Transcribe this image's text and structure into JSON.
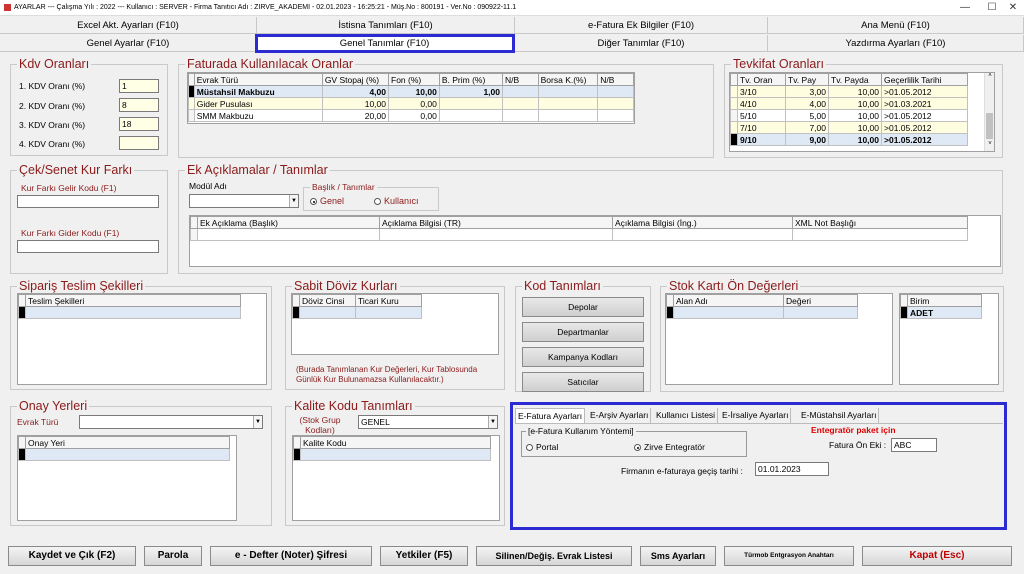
{
  "window": {
    "title": "AYARLAR --- Çalışma Yılı : 2022 --- Kullanıcı : SERVER - Firma Tanıtıcı Adı : ZIRVE_AKADEMI - 02.01.2023 - 16:25:21 - Müş.No : 800191 - Ver.No : 090922-11.1"
  },
  "tabs_row1": [
    "Excel Akt. Ayarları (F10)",
    "İstisna Tanımları (F10)",
    "e-Fatura Ek Bilgiler (F10)",
    "Ana Menü (F10)"
  ],
  "tabs_row2": [
    "Genel Ayarlar (F10)",
    "Genel Tanımlar (F10)",
    "Diğer Tanımlar (F10)",
    "Yazdırma Ayarları (F10)"
  ],
  "kdv": {
    "title": "Kdv Oranları",
    "labels": [
      "1. KDV Oranı (%)",
      "2. KDV Oranı (%)",
      "3. KDV Oranı (%)",
      "4. KDV Oranı (%)"
    ],
    "values": [
      "1",
      "8",
      "18",
      ""
    ]
  },
  "faturada": {
    "title": "Faturada Kullanılacak Oranlar",
    "headers": [
      "Evrak Türü",
      "GV Stopaj (%)",
      "Fon (%)",
      "B. Prim (%)",
      "N/B",
      "Borsa K.(%)",
      "N/B"
    ],
    "rows": [
      [
        "Müstahsil Makbuzu",
        "4,00",
        "10,00",
        "1,00",
        "",
        "",
        ""
      ],
      [
        "Gider Pusulası",
        "10,00",
        "0,00",
        "",
        "",
        "",
        ""
      ],
      [
        "SMM Makbuzu",
        "20,00",
        "0,00",
        "",
        "",
        "",
        ""
      ]
    ]
  },
  "tevkifat": {
    "title": "Tevkifat Oranları",
    "headers": [
      "Tv. Oran",
      "Tv. Pay",
      "Tv. Payda",
      "Geçerlilik Tarihi"
    ],
    "rows": [
      [
        "3/10",
        "3,00",
        "10,00",
        ">01.05.2012"
      ],
      [
        "4/10",
        "4,00",
        "10,00",
        ">01.03.2021"
      ],
      [
        "5/10",
        "5,00",
        "10,00",
        ">01.05.2012"
      ],
      [
        "7/10",
        "7,00",
        "10,00",
        ">01.05.2012"
      ],
      [
        "9/10",
        "9,00",
        "10,00",
        ">01.05.2012"
      ]
    ]
  },
  "cek_senet": {
    "title": "Çek/Senet Kur Farkı",
    "gelir_label": "Kur Farkı Gelir Kodu (F1)",
    "gider_label": "Kur Farkı Gider Kodu (F1)"
  },
  "ek_aciklama": {
    "title": "Ek Açıklamalar / Tanımlar",
    "modul_label": "Modül Adı",
    "baslik_group": "Başlık / Tanımlar",
    "radio_genel": "Genel",
    "radio_kullanici": "Kullanıcı",
    "headers": [
      "Ek Açıklama (Başlık)",
      "Açıklama Bilgisi (TR)",
      "Açıklama Bilgisi (İng.)",
      "XML Not Başlığı"
    ]
  },
  "siparis": {
    "title": "Sipariş Teslim Şekilleri",
    "header": "Teslim Şekilleri"
  },
  "sabit_doviz": {
    "title": "Sabit Döviz Kurları",
    "headers": [
      "Döviz Cinsi",
      "Ticari Kuru"
    ],
    "note": "(Burada Tanımlanan Kur Değerleri, Kur Tablosunda Günlük Kur Bulunamazsa Kullanılacaktır.)"
  },
  "kod_tanimlari": {
    "title": "Kod Tanımları",
    "buttons": [
      "Depolar",
      "Departmanlar",
      "Kampanya Kodları",
      "Satıcılar"
    ]
  },
  "stok_karti": {
    "title": "Stok Kartı Ön Değerleri",
    "headers": [
      "Alan Adı",
      "Değeri"
    ],
    "birim_header": "Birim",
    "birim_value": "ADET"
  },
  "onay": {
    "title": "Onay Yerleri",
    "evrak_label": "Evrak Türü",
    "header": "Onay Yeri"
  },
  "kalite": {
    "title": "Kalite Kodu Tanımları",
    "grup_label": "(Stok Grup Kodları)",
    "grup_value": "GENEL",
    "header": "Kalite Kodu"
  },
  "efatura": {
    "tabs": [
      "E-Fatura Ayarları",
      "E-Arşiv Ayarları",
      "Kullanıcı Listesi",
      "E-İrsaliye Ayarları",
      "E-Müstahsil Ayarları"
    ],
    "yontem_title": "[e-Fatura Kullanım Yöntemi]",
    "radio_portal": "Portal",
    "radio_zirve": "Zirve Entegratör",
    "entegrator_note": "Entegratör paket için",
    "on_ek_label": "Fatura Ön Eki :",
    "on_ek_value": "ABC",
    "gecis_label": "Firmanın e-faturaya geçiş tarihi :",
    "gecis_value": "01.01.2023"
  },
  "bottom_buttons": [
    "Kaydet ve Çık (F2)",
    "Parola",
    "e - Defter (Noter) Şifresi",
    "Yetkiler (F5)",
    "Silinen/Değiş. Evrak Listesi",
    "Sms Ayarları",
    "Türmob Entgrasyon Anahtarı",
    "Kapat (Esc)"
  ],
  "colors": {
    "accent_border": "#2b2bd1",
    "title_red": "#8b1a1a",
    "kapat_red": "#c00000"
  }
}
